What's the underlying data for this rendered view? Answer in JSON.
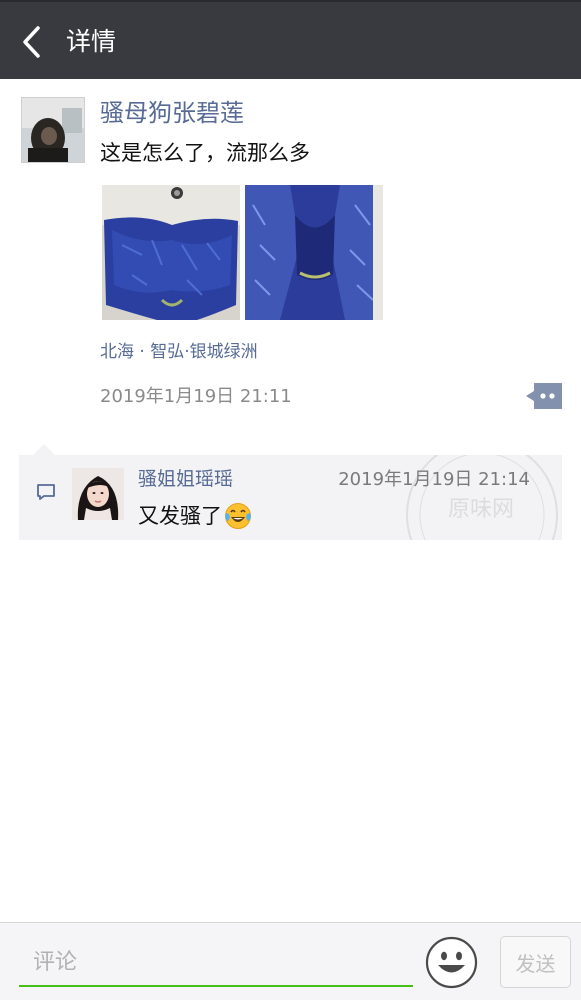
{
  "header": {
    "title": "详情"
  },
  "post": {
    "username": "骚母狗张碧莲",
    "text": "这是怎么了，流那么多",
    "location": "北海 · 智弘·银城绿洲",
    "timestamp": "2019年1月19日 21:11"
  },
  "comment": {
    "username": "骚姐姐瑶瑶",
    "time": "2019年1月19日 21:14",
    "text": "又发骚了"
  },
  "watermark": {
    "text": "原味网"
  },
  "input": {
    "placeholder": "评论",
    "send_label": "发送"
  },
  "colors": {
    "header_bg": "#393a3f",
    "link_blue": "#576b95",
    "input_underline": "#45c01a",
    "comment_bg": "#f3f3f5"
  }
}
